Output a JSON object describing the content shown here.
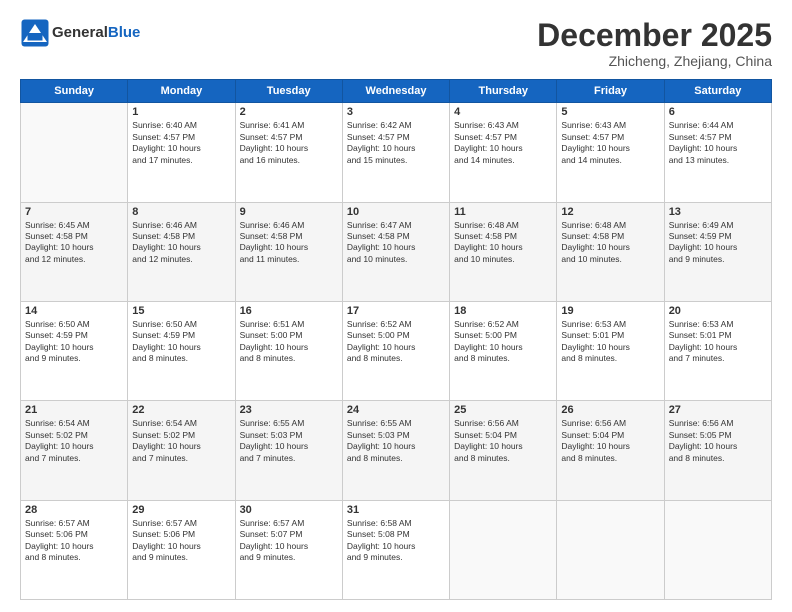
{
  "header": {
    "logo_line1": "General",
    "logo_line2": "Blue",
    "month_title": "December 2025",
    "location": "Zhicheng, Zhejiang, China"
  },
  "days_of_week": [
    "Sunday",
    "Monday",
    "Tuesday",
    "Wednesday",
    "Thursday",
    "Friday",
    "Saturday"
  ],
  "weeks": [
    [
      {
        "day": "",
        "info": ""
      },
      {
        "day": "1",
        "info": "Sunrise: 6:40 AM\nSunset: 4:57 PM\nDaylight: 10 hours\nand 17 minutes."
      },
      {
        "day": "2",
        "info": "Sunrise: 6:41 AM\nSunset: 4:57 PM\nDaylight: 10 hours\nand 16 minutes."
      },
      {
        "day": "3",
        "info": "Sunrise: 6:42 AM\nSunset: 4:57 PM\nDaylight: 10 hours\nand 15 minutes."
      },
      {
        "day": "4",
        "info": "Sunrise: 6:43 AM\nSunset: 4:57 PM\nDaylight: 10 hours\nand 14 minutes."
      },
      {
        "day": "5",
        "info": "Sunrise: 6:43 AM\nSunset: 4:57 PM\nDaylight: 10 hours\nand 14 minutes."
      },
      {
        "day": "6",
        "info": "Sunrise: 6:44 AM\nSunset: 4:57 PM\nDaylight: 10 hours\nand 13 minutes."
      }
    ],
    [
      {
        "day": "7",
        "info": "Sunrise: 6:45 AM\nSunset: 4:58 PM\nDaylight: 10 hours\nand 12 minutes."
      },
      {
        "day": "8",
        "info": "Sunrise: 6:46 AM\nSunset: 4:58 PM\nDaylight: 10 hours\nand 12 minutes."
      },
      {
        "day": "9",
        "info": "Sunrise: 6:46 AM\nSunset: 4:58 PM\nDaylight: 10 hours\nand 11 minutes."
      },
      {
        "day": "10",
        "info": "Sunrise: 6:47 AM\nSunset: 4:58 PM\nDaylight: 10 hours\nand 10 minutes."
      },
      {
        "day": "11",
        "info": "Sunrise: 6:48 AM\nSunset: 4:58 PM\nDaylight: 10 hours\nand 10 minutes."
      },
      {
        "day": "12",
        "info": "Sunrise: 6:48 AM\nSunset: 4:58 PM\nDaylight: 10 hours\nand 10 minutes."
      },
      {
        "day": "13",
        "info": "Sunrise: 6:49 AM\nSunset: 4:59 PM\nDaylight: 10 hours\nand 9 minutes."
      }
    ],
    [
      {
        "day": "14",
        "info": "Sunrise: 6:50 AM\nSunset: 4:59 PM\nDaylight: 10 hours\nand 9 minutes."
      },
      {
        "day": "15",
        "info": "Sunrise: 6:50 AM\nSunset: 4:59 PM\nDaylight: 10 hours\nand 8 minutes."
      },
      {
        "day": "16",
        "info": "Sunrise: 6:51 AM\nSunset: 5:00 PM\nDaylight: 10 hours\nand 8 minutes."
      },
      {
        "day": "17",
        "info": "Sunrise: 6:52 AM\nSunset: 5:00 PM\nDaylight: 10 hours\nand 8 minutes."
      },
      {
        "day": "18",
        "info": "Sunrise: 6:52 AM\nSunset: 5:00 PM\nDaylight: 10 hours\nand 8 minutes."
      },
      {
        "day": "19",
        "info": "Sunrise: 6:53 AM\nSunset: 5:01 PM\nDaylight: 10 hours\nand 8 minutes."
      },
      {
        "day": "20",
        "info": "Sunrise: 6:53 AM\nSunset: 5:01 PM\nDaylight: 10 hours\nand 7 minutes."
      }
    ],
    [
      {
        "day": "21",
        "info": "Sunrise: 6:54 AM\nSunset: 5:02 PM\nDaylight: 10 hours\nand 7 minutes."
      },
      {
        "day": "22",
        "info": "Sunrise: 6:54 AM\nSunset: 5:02 PM\nDaylight: 10 hours\nand 7 minutes."
      },
      {
        "day": "23",
        "info": "Sunrise: 6:55 AM\nSunset: 5:03 PM\nDaylight: 10 hours\nand 7 minutes."
      },
      {
        "day": "24",
        "info": "Sunrise: 6:55 AM\nSunset: 5:03 PM\nDaylight: 10 hours\nand 8 minutes."
      },
      {
        "day": "25",
        "info": "Sunrise: 6:56 AM\nSunset: 5:04 PM\nDaylight: 10 hours\nand 8 minutes."
      },
      {
        "day": "26",
        "info": "Sunrise: 6:56 AM\nSunset: 5:04 PM\nDaylight: 10 hours\nand 8 minutes."
      },
      {
        "day": "27",
        "info": "Sunrise: 6:56 AM\nSunset: 5:05 PM\nDaylight: 10 hours\nand 8 minutes."
      }
    ],
    [
      {
        "day": "28",
        "info": "Sunrise: 6:57 AM\nSunset: 5:06 PM\nDaylight: 10 hours\nand 8 minutes."
      },
      {
        "day": "29",
        "info": "Sunrise: 6:57 AM\nSunset: 5:06 PM\nDaylight: 10 hours\nand 9 minutes."
      },
      {
        "day": "30",
        "info": "Sunrise: 6:57 AM\nSunset: 5:07 PM\nDaylight: 10 hours\nand 9 minutes."
      },
      {
        "day": "31",
        "info": "Sunrise: 6:58 AM\nSunset: 5:08 PM\nDaylight: 10 hours\nand 9 minutes."
      },
      {
        "day": "",
        "info": ""
      },
      {
        "day": "",
        "info": ""
      },
      {
        "day": "",
        "info": ""
      }
    ]
  ]
}
